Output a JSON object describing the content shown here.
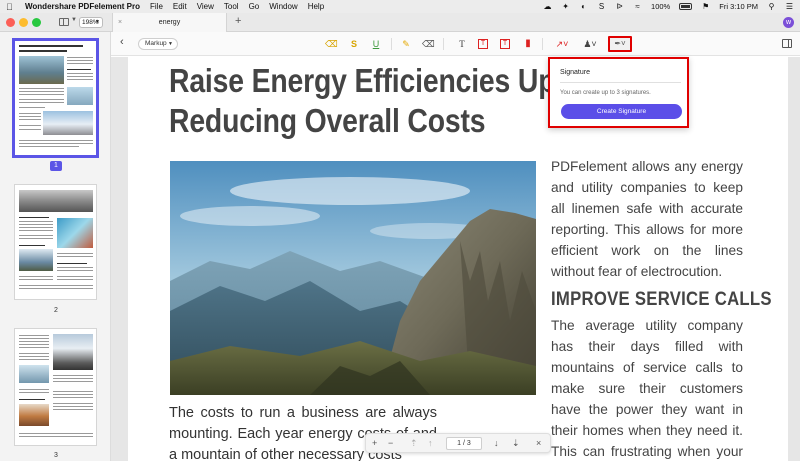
{
  "menubar": {
    "app_name": "Wondershare PDFelement Pro",
    "items": [
      "File",
      "Edit",
      "View",
      "Tool",
      "Go",
      "Window",
      "Help"
    ],
    "battery": "100%",
    "clock": "Fri 3:10 PM"
  },
  "tabbar": {
    "zoom": "198%",
    "tab_title": "energy",
    "new_tab": "+",
    "profile_initial": "w"
  },
  "toolbar": {
    "mode_label": "Markup"
  },
  "thumbnails": {
    "pages": [
      "1",
      "2",
      "3"
    ],
    "selected": "1"
  },
  "document": {
    "title_line1": "Raise Energy Efficiencies Up",
    "title_line2": "Reducing Overall Costs",
    "body_left": "The costs to run a business are always mounting. Each year energy costs of and a mountain of other necessary costs",
    "right_p1": "PDFelement allows any energy and utility companies to keep all linemen safe with accurate reporting. This allows for more efficient work on the lines without fear of electrocution.",
    "heading": "IMPROVE SERVICE CALLS",
    "right_p2": "The average utility company has their days filled with mountains of service calls to make sure their customers have the power they want in their homes when they need it. This can frustrating when your current"
  },
  "page_nav": {
    "current": "1",
    "total": "3"
  },
  "signature_popover": {
    "title": "Signature",
    "description": "You can create up to 3 signatures.",
    "button": "Create Signature"
  }
}
